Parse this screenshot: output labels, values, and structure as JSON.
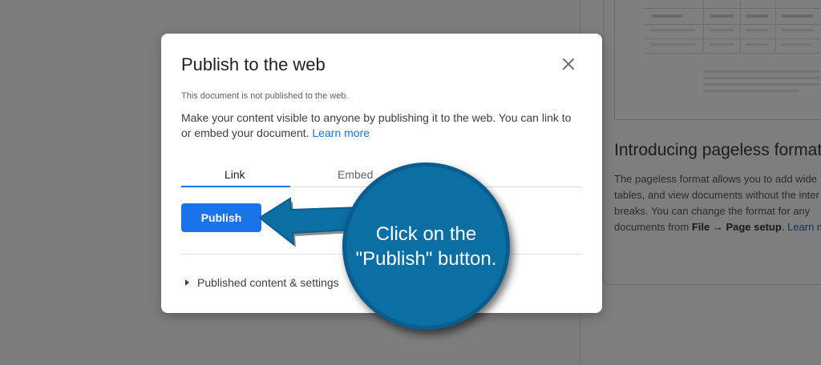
{
  "background": {
    "heading": "Introducing pageless format",
    "paragraph": {
      "line1": "The pageless format allows you to add wide",
      "line2": "tables, and view documents without the inter",
      "line3": "breaks. You can change the format for any",
      "line4_prefix": "documents from ",
      "line4_bold": "File → Page setup",
      "line4_mid": ". ",
      "line4_link": "Learn more"
    }
  },
  "dialog": {
    "title": "Publish to the web",
    "status": "This document is not published to the web.",
    "description": "Make your content visible to anyone by publishing it to the web. You can link to or embed your document. ",
    "learn_more": "Learn more",
    "tabs": [
      {
        "label": "Link",
        "active": true
      },
      {
        "label": "Embed",
        "active": false
      }
    ],
    "publish_button": "Publish",
    "settings_toggle": "Published content & settings"
  },
  "callout": {
    "line1": "Click on the",
    "line2": "\"Publish\" button."
  },
  "colors": {
    "accent": "#1a73e8",
    "callout_fill": "#0b6fa4",
    "overlay": "#7d7d7d"
  },
  "icons": {
    "close": "close-icon",
    "caret": "caret-right-icon"
  }
}
